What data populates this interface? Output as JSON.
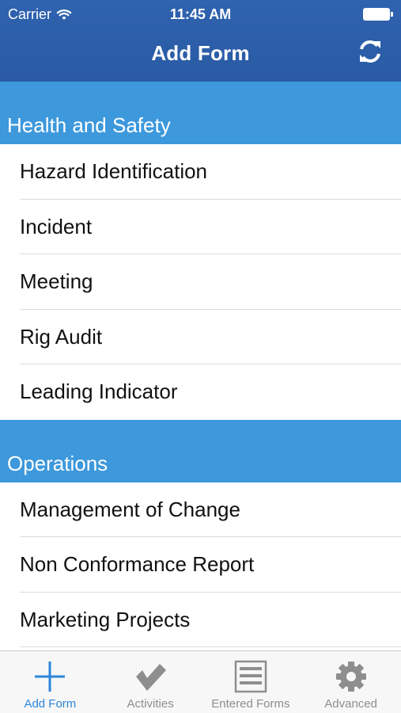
{
  "status_bar": {
    "carrier": "Carrier",
    "time": "11:45 AM"
  },
  "nav": {
    "title": "Add Form",
    "refresh_icon": "refresh-icon"
  },
  "sections": [
    {
      "header": "Health and Safety",
      "items": [
        "Hazard Identification",
        "Incident",
        "Meeting",
        "Rig Audit",
        "Leading Indicator"
      ]
    },
    {
      "header": "Operations",
      "items": [
        "Management of Change",
        "Non Conformance Report",
        "Marketing Projects"
      ]
    }
  ],
  "tabs": [
    {
      "label": "Add Form",
      "icon": "plus-icon",
      "active": true
    },
    {
      "label": "Activities",
      "icon": "checkmark-icon",
      "active": false
    },
    {
      "label": "Entered Forms",
      "icon": "forms-list-icon",
      "active": false
    },
    {
      "label": "Advanced",
      "icon": "gear-icon",
      "active": false
    }
  ],
  "colors": {
    "nav_bar": "#2f63b0",
    "section_header": "#3d98dc",
    "active_tab": "#2b86d8",
    "inactive_tab": "#8e8e8e"
  }
}
